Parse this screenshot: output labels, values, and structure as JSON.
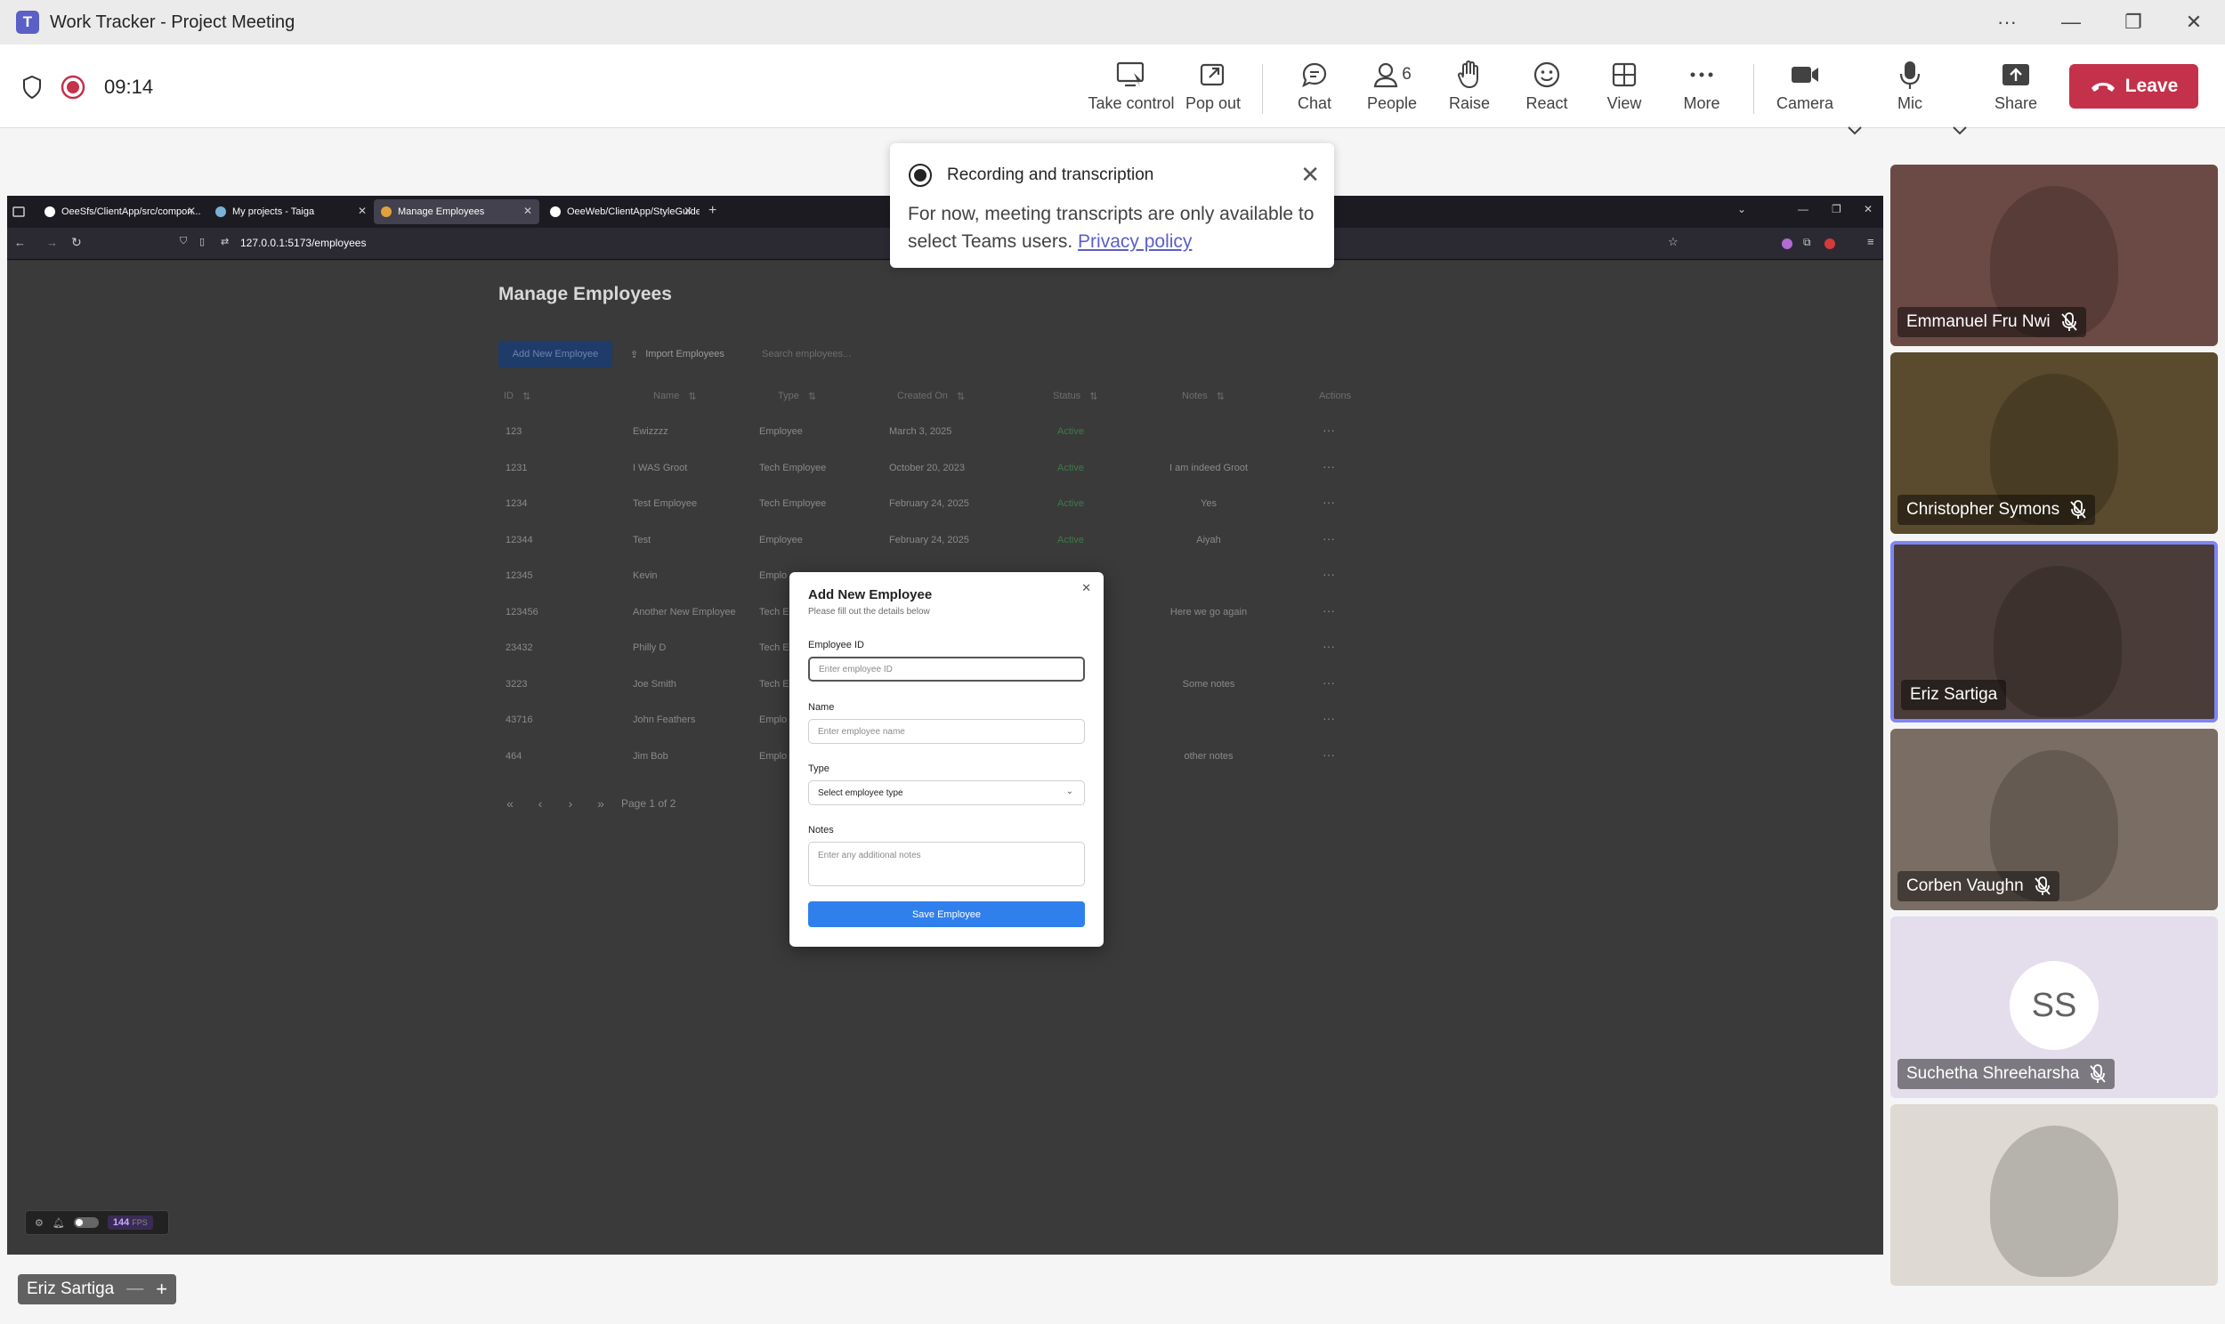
{
  "window": {
    "title": "Work Tracker - Project Meeting",
    "teams_icon": "T"
  },
  "call": {
    "timer": "09:14"
  },
  "toolbar": {
    "take_control": "Take control",
    "pop_out": "Pop out",
    "chat": "Chat",
    "people": "People",
    "people_count": "6",
    "raise": "Raise",
    "react": "React",
    "view": "View",
    "more": "More",
    "camera": "Camera",
    "mic": "Mic",
    "share": "Share",
    "leave": "Leave"
  },
  "toast": {
    "title": "Recording and transcription",
    "body": "For now, meeting transcripts are only available to select Teams users.",
    "link": "Privacy policy"
  },
  "browser": {
    "tabs": [
      "OeeSfs/ClientApp/src/compon...",
      "My projects - Taiga",
      "Manage Employees",
      "OeeWeb/ClientApp/StyleGuide"
    ],
    "url": "127.0.0.1:5173/employees"
  },
  "page": {
    "title": "Manage Employees",
    "add_button": "Add New Employee",
    "import_button": "Import Employees",
    "search_placeholder": "Search employees...",
    "columns": [
      "ID",
      "Name",
      "Type",
      "Created On",
      "Status",
      "Notes",
      "Actions"
    ],
    "rows": [
      {
        "id": "123",
        "name": "Ewizzzz",
        "type": "Employee",
        "created": "March 3, 2025",
        "status": "Active",
        "notes": ""
      },
      {
        "id": "1231",
        "name": "I WAS Groot",
        "type": "Tech Employee",
        "created": "October 20, 2023",
        "status": "Active",
        "notes": "I am indeed Groot"
      },
      {
        "id": "1234",
        "name": "Test Employee",
        "type": "Tech Employee",
        "created": "February 24, 2025",
        "status": "Active",
        "notes": "Yes"
      },
      {
        "id": "12344",
        "name": "Test",
        "type": "Employee",
        "created": "February 24, 2025",
        "status": "Active",
        "notes": "Aiyah"
      },
      {
        "id": "12345",
        "name": "Kevin",
        "type": "Emplo",
        "created": "",
        "status": "",
        "notes": ""
      },
      {
        "id": "123456",
        "name": "Another New Employee",
        "type": "Tech E",
        "created": "",
        "status": "",
        "notes": "Here we go again"
      },
      {
        "id": "23432",
        "name": "Philly D",
        "type": "Tech E",
        "created": "",
        "status": "",
        "notes": ""
      },
      {
        "id": "3223",
        "name": "Joe Smith",
        "type": "Tech E",
        "created": "",
        "status": "",
        "notes": "Some notes"
      },
      {
        "id": "43716",
        "name": "John Feathers",
        "type": "Emplo",
        "created": "",
        "status": "",
        "notes": ""
      },
      {
        "id": "464",
        "name": "Jim Bob",
        "type": "Emplo",
        "created": "",
        "status": "",
        "notes": "other notes"
      }
    ],
    "actions_glyph": "···",
    "pagination": "Page 1 of 2"
  },
  "modal": {
    "title": "Add New Employee",
    "subtitle": "Please fill out the details below",
    "id_label": "Employee ID",
    "id_placeholder": "Enter employee ID",
    "name_label": "Name",
    "name_placeholder": "Enter employee name",
    "type_label": "Type",
    "type_value": "Select employee type",
    "notes_label": "Notes",
    "notes_placeholder": "Enter any additional notes",
    "save": "Save Employee"
  },
  "fps": {
    "value": "144",
    "unit": "FPS"
  },
  "participants": [
    {
      "name": "Emmanuel Fru Nwi",
      "muted": true,
      "bg": "#6b4a45"
    },
    {
      "name": "Christopher Symons",
      "muted": true,
      "bg": "#5a4a2e"
    },
    {
      "name": "Eriz Sartiga",
      "muted": false,
      "active": true,
      "bg": "#4a3c38"
    },
    {
      "name": "Corben Vaughn",
      "muted": true,
      "bg": "#7a6e64"
    },
    {
      "name": "Suchetha Shreeharsha",
      "muted": true,
      "initials": "SS",
      "bg": "#e4ddec"
    },
    {
      "name": "",
      "muted": false,
      "bg": "#ded9d2"
    }
  ],
  "presenter": {
    "name": "Eriz Sartiga"
  },
  "colors": {
    "accent": "#5b5fc7",
    "leave": "#c4314b",
    "record": "#c4314b"
  }
}
